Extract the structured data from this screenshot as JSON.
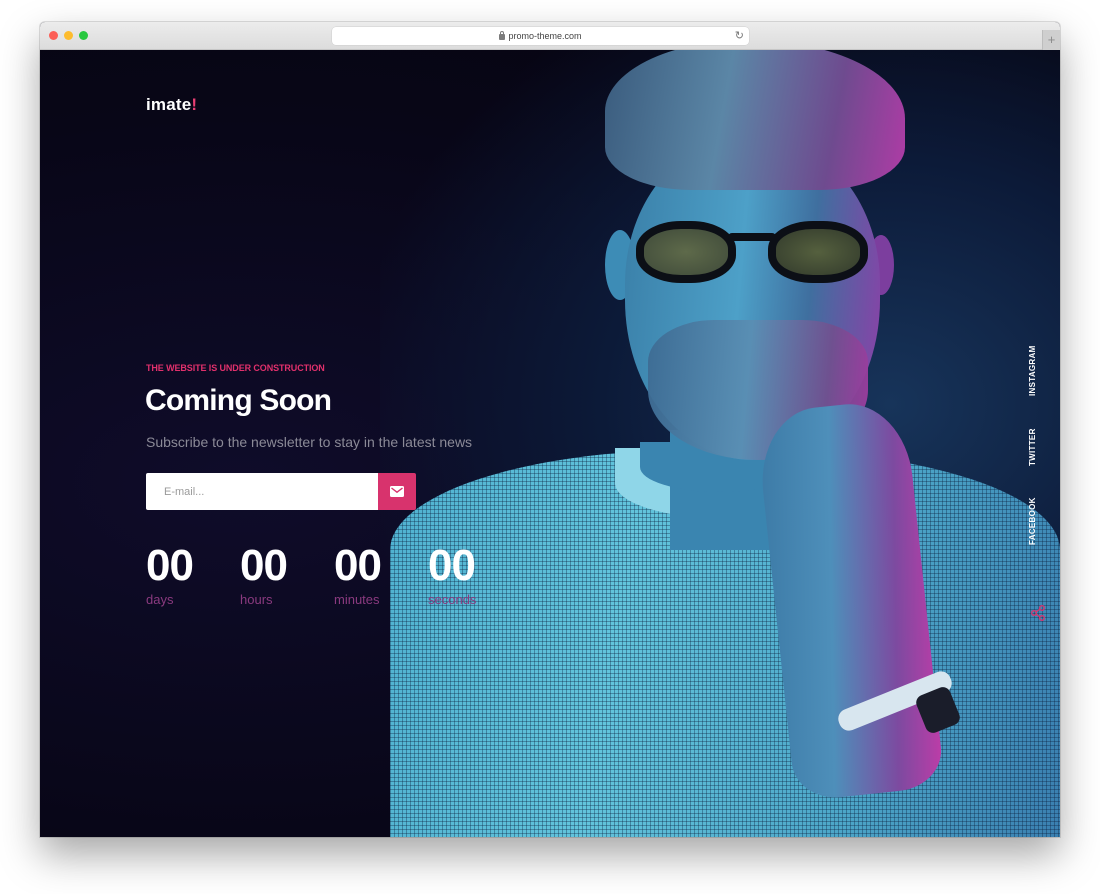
{
  "browser": {
    "url": "promo-theme.com",
    "new_tab_label": "+"
  },
  "brand": {
    "name": "imate",
    "mark": "!",
    "accent_color": "#e1306c"
  },
  "hero": {
    "eyebrow": "THE WEBSITE IS UNDER CONSTRUCTION",
    "title": "Coming Soon",
    "subtitle": "Subscribe to the newsletter to stay in the latest news"
  },
  "newsletter": {
    "email_value": "",
    "email_placeholder": "E-mail...",
    "submit_icon": "envelope-icon"
  },
  "countdown": [
    {
      "value": "00",
      "label": "days"
    },
    {
      "value": "00",
      "label": "hours"
    },
    {
      "value": "00",
      "label": "minutes"
    },
    {
      "value": "00",
      "label": "seconds"
    }
  ],
  "social": {
    "links": [
      "INSTAGRAM",
      "TWITTER",
      "FACEBOOK"
    ],
    "share_icon": "share-icon"
  }
}
